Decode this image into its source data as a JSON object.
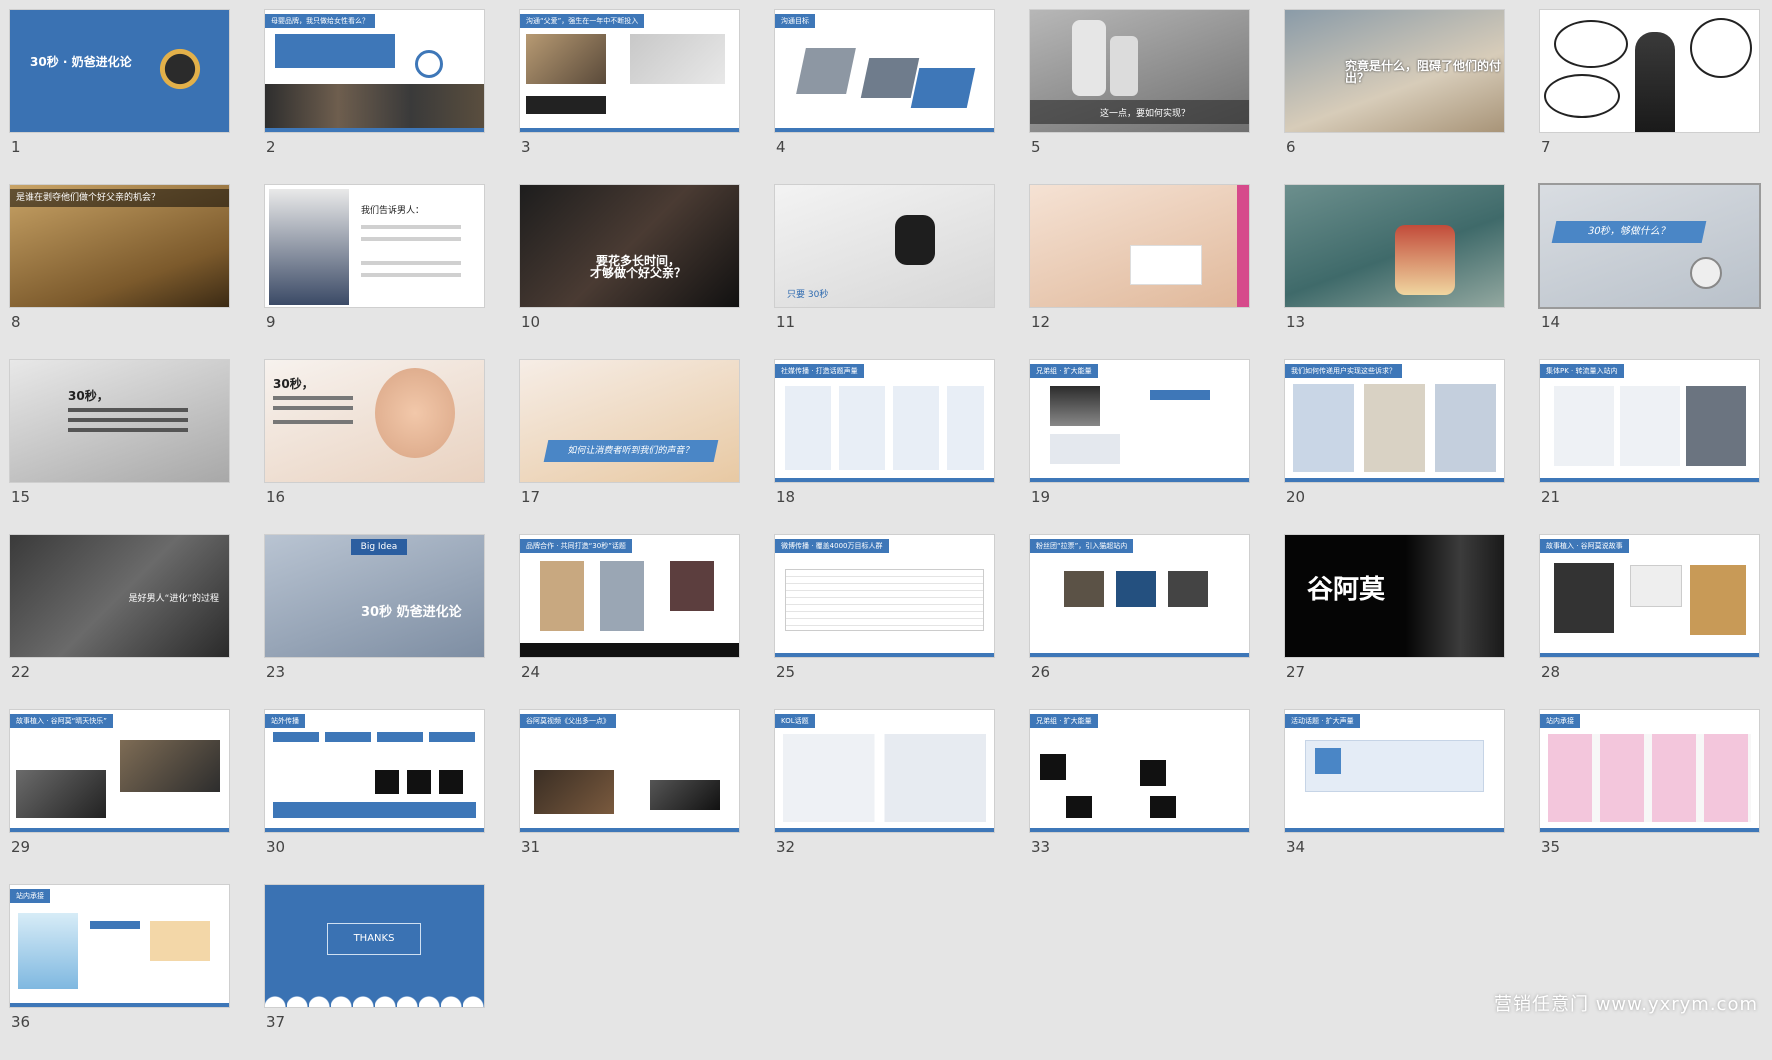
{
  "slides": [
    {
      "number": "1",
      "text": "30秒 · 奶爸进化论"
    },
    {
      "number": "2",
      "text": "母婴品牌，我只做给女性看么？"
    },
    {
      "number": "3",
      "text": "沟通“父爱”，强生在一年中不断投入"
    },
    {
      "number": "4",
      "text": "沟通目标"
    },
    {
      "number": "5",
      "text": "这一点，要如何实现？"
    },
    {
      "number": "6",
      "text": "究竟是什么，阻碍了他们的付出？"
    },
    {
      "number": "7",
      "text": ""
    },
    {
      "number": "8",
      "text": "是谁在剥夺他们做个好父亲的机会？"
    },
    {
      "number": "9",
      "text": "我们告诉男人："
    },
    {
      "number": "10",
      "text": "要花多长时间，\n才够做个好父亲？"
    },
    {
      "number": "11",
      "text": "只要 30秒"
    },
    {
      "number": "12",
      "text": ""
    },
    {
      "number": "13",
      "text": ""
    },
    {
      "number": "14",
      "text": "30秒，够做什么？"
    },
    {
      "number": "15",
      "text": "30秒，"
    },
    {
      "number": "16",
      "text": "30秒，"
    },
    {
      "number": "17",
      "text": "如何让消费者听到我们的声音？"
    },
    {
      "number": "18",
      "text": "社媒传播 · 打造话题声量"
    },
    {
      "number": "19",
      "text": "兄弟组 · 扩大能量"
    },
    {
      "number": "20",
      "text": "我们如何传递用户实现这些诉求？"
    },
    {
      "number": "21",
      "text": "集体PK · 转流量入站内"
    },
    {
      "number": "22",
      "text": "是好男人“进化”的过程"
    },
    {
      "number": "23",
      "text": "30秒 奶爸进化论"
    },
    {
      "number": "24",
      "text": "品牌合作 · 共同打造“30秒”话题"
    },
    {
      "number": "25",
      "text": "微博传播 · 覆盖4000万目标人群"
    },
    {
      "number": "26",
      "text": "粉丝团“拉票”，引入猫超站内"
    },
    {
      "number": "27",
      "text": "谷阿莫"
    },
    {
      "number": "28",
      "text": "故事植入 · 谷阿莫说故事"
    },
    {
      "number": "29",
      "text": "故事植入 · 谷阿莫“晴天快乐”"
    },
    {
      "number": "30",
      "text": "站外传播"
    },
    {
      "number": "31",
      "text": "谷阿莫视频《父出多一点》"
    },
    {
      "number": "32",
      "text": "KOL话题"
    },
    {
      "number": "33",
      "text": "兄弟组 · 扩大能量"
    },
    {
      "number": "34",
      "text": "活动话题 · 扩大声量"
    },
    {
      "number": "35",
      "text": "站内承接"
    },
    {
      "number": "36",
      "text": "站内承接"
    },
    {
      "number": "37",
      "text": "THANKS"
    }
  ],
  "selected_slide": "14",
  "watermark": "营销任意门 www.yxrym.com"
}
